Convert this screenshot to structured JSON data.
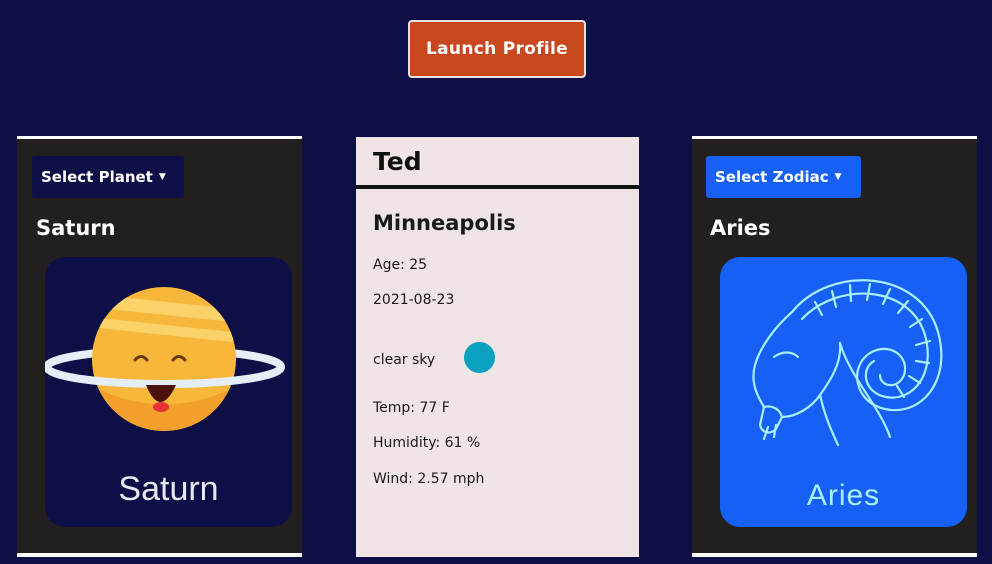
{
  "header": {
    "launch_label": "Launch Profile"
  },
  "planet_panel": {
    "dropdown_label": "Select Planet",
    "selected_planet": "Saturn",
    "image_caption": "Saturn"
  },
  "profile": {
    "name": "Ted",
    "city": "Minneapolis",
    "age": "Age: 25",
    "date": "2021-08-23",
    "weather_desc": "clear sky",
    "temp": "Temp: 77 F",
    "humidity": "Humidity: 61 %",
    "wind": "Wind: 2.57 mph"
  },
  "zodiac_panel": {
    "dropdown_label": "Select Zodiac",
    "selected_sign": "Aries",
    "image_caption": "Aries"
  },
  "colors": {
    "background": "#0f0f47",
    "launch_button": "#c9471f",
    "zodiac_blue": "#1660f5",
    "card_dark": "#231f1e",
    "profile_card": "#efe5e5",
    "weather_icon": "#0aa0bf"
  }
}
